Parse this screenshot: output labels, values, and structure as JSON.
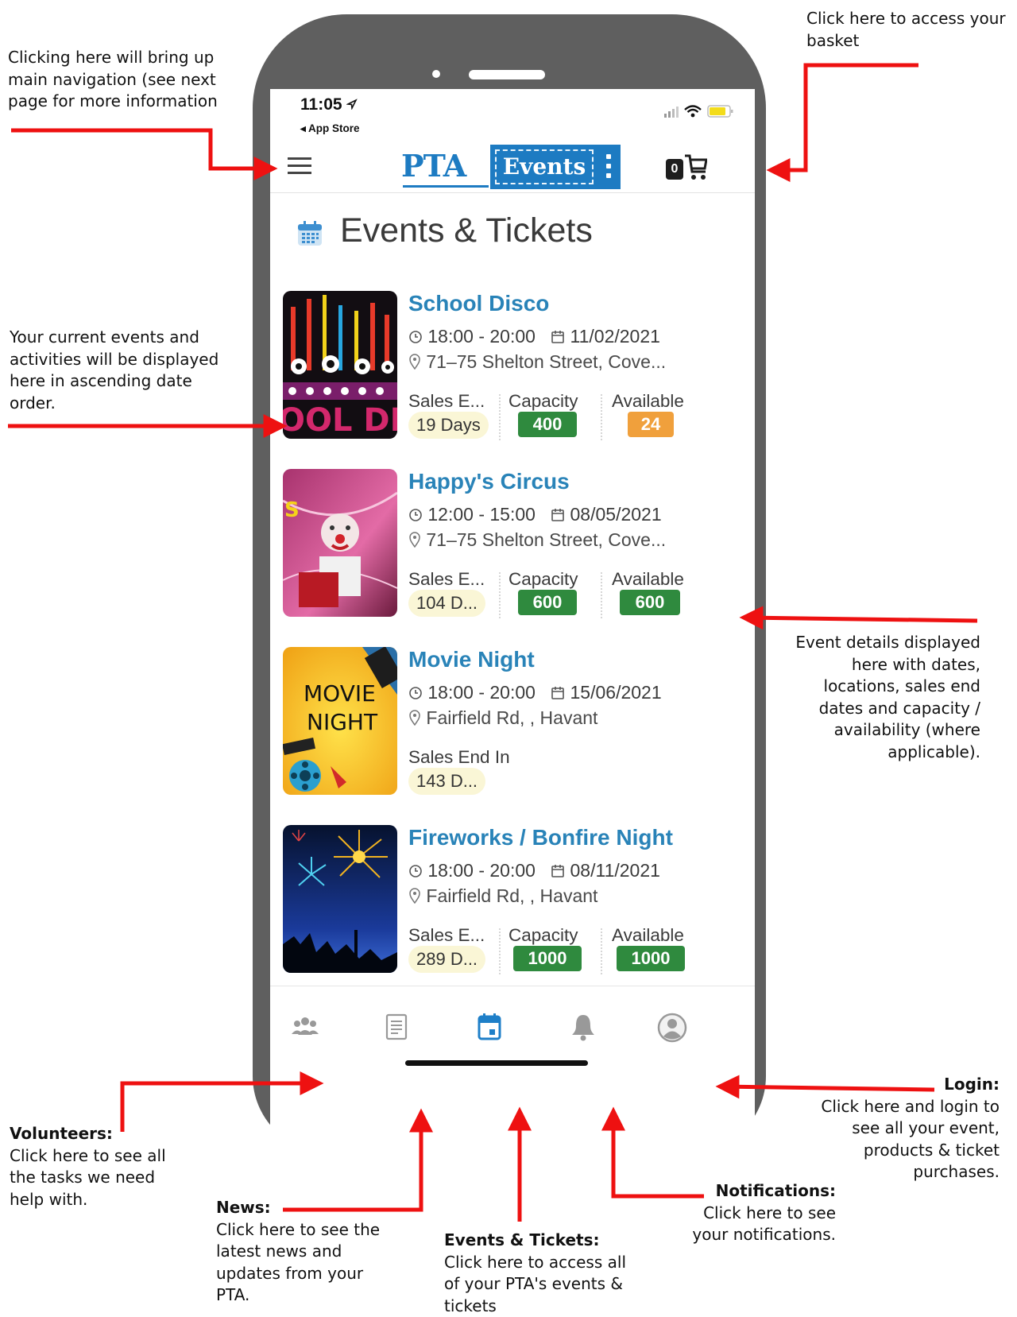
{
  "annotations": {
    "basket": "Click here to access your basket",
    "menu": "Clicking here will bring up main navigation (see next page for more information",
    "events_list": "Your current events and activities will be displayed here in ascending date order.",
    "event_details": "Event details displayed here with dates, locations, sales end dates and capacity / availability (where applicable).",
    "login_title": "Login:",
    "login_text": "Click here and login to see all your event, products & ticket purchases.",
    "volunteers_title": "Volunteers:",
    "volunteers_text": "Click here to see all the tasks we need help with.",
    "news_title": "News:",
    "news_text": "Click here to see the latest news and updates from your PTA.",
    "events_title": "Events & Tickets:",
    "events_text": "Click here to access all of your PTA's events & tickets",
    "notifications_title": "Notifications:",
    "notifications_text": "Click here to see your notifications."
  },
  "status_bar": {
    "time": "11:05",
    "back_label": "◂ App Store"
  },
  "app_bar": {
    "logo_left": "PTA",
    "logo_right": "Events",
    "cart_count": "0"
  },
  "page": {
    "title": "Events & Tickets"
  },
  "events": [
    {
      "title": "School Disco",
      "time": "18:00 - 20:00",
      "date": "11/02/2021",
      "location": "71–75 Shelton Street, Cove...",
      "sales_label": "Sales E...",
      "sales_value": "19 Days",
      "capacity_label": "Capacity",
      "capacity_value": "400",
      "available_label": "Available",
      "available_value": "24",
      "available_color": "#f0a03c"
    },
    {
      "title": "Happy's Circus",
      "time": "12:00 - 15:00",
      "date": "08/05/2021",
      "location": "71–75 Shelton Street, Cove...",
      "sales_label": "Sales E...",
      "sales_value": "104 D...",
      "capacity_label": "Capacity",
      "capacity_value": "600",
      "available_label": "Available",
      "available_value": "600",
      "available_color": "#2f8a3e"
    },
    {
      "title": "Movie Night",
      "time": "18:00 - 20:00",
      "date": "15/06/2021",
      "location": "Fairfield Rd, , Havant",
      "sales_label": "Sales End In",
      "sales_value": "143 D..."
    },
    {
      "title": "Fireworks / Bonfire Night",
      "time": "18:00 - 20:00",
      "date": "08/11/2021",
      "location": "Fairfield Rd, , Havant",
      "sales_label": "Sales E...",
      "sales_value": "289 D...",
      "capacity_label": "Capacity",
      "capacity_value": "1000",
      "available_label": "Available",
      "available_value": "1000",
      "available_color": "#2f8a3e"
    }
  ],
  "thumb_text": {
    "disco": "OOL DI",
    "movie_1": "MOVIE",
    "movie_2": "NIGHT"
  },
  "colors": {
    "accent": "#2983b8",
    "brand": "#1d7bc2",
    "capacity": "#2f8a3e",
    "arrow": "#ee1111",
    "nav_active": "#1e7fc8"
  },
  "bottom_nav": [
    "volunteers-icon",
    "news-icon",
    "calendar-icon",
    "bell-icon",
    "user-icon"
  ]
}
